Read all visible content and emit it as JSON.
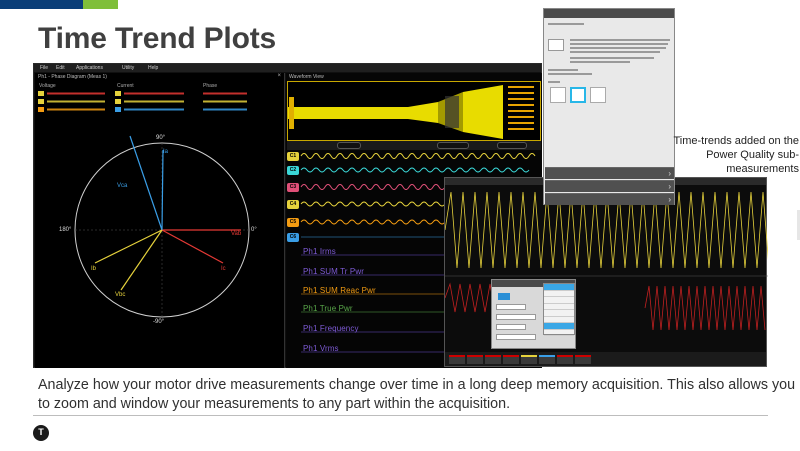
{
  "page": {
    "title": "Time Trend Plots"
  },
  "scope": {
    "menu": [
      "File",
      "Edit",
      "Applications",
      "Utility",
      "Help"
    ],
    "phase_diagram": {
      "title": "Ph1 - Phase Diagram (Meas 1)",
      "headers": [
        "Voltage",
        "Current",
        "Phase"
      ],
      "axis_labels": {
        "top": "90°",
        "bottom": "-90°",
        "left": "180°",
        "right": "0°"
      },
      "vectors": [
        "Vca",
        "Ia",
        "Vab",
        "Ib",
        "Vbc",
        "Ic"
      ],
      "colors": {
        "ab": "#e53935",
        "bc": "#e6d23c",
        "ca": "#3a9ee6"
      }
    },
    "waveform_view": {
      "title": "Waveform View",
      "overlay_color": "#f2e600",
      "meas_labels": [
        {
          "text": "Ph1 Irms",
          "color": "#7e5bd6"
        },
        {
          "text": "Ph1 SUM Tr Pwr",
          "color": "#7e5bd6"
        },
        {
          "text": "Ph1 SUM Reac Pwr",
          "color": "#f39c12"
        },
        {
          "text": "Ph1 True Pwr",
          "color": "#5aa84a"
        },
        {
          "text": "Ph1 Frequency",
          "color": "#7e5bd6"
        },
        {
          "text": "Ph1 Vrms",
          "color": "#7e5bd6"
        }
      ]
    }
  },
  "callout": "Time-trends added on the Power Quality sub-measurements",
  "caption": "Analyze how your motor drive measurements change over time in a long deep memory acquisition. This also allows you to zoom and window your measurements to any part within the acquisition.",
  "logo": {
    "letter": "T"
  }
}
